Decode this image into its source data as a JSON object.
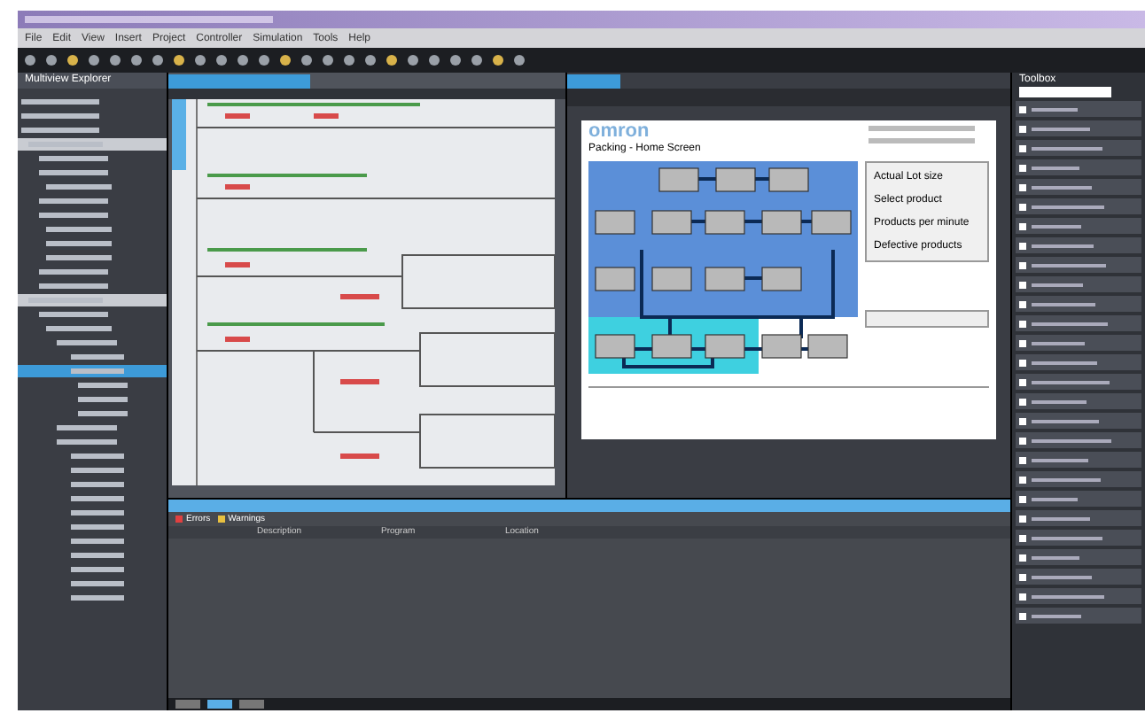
{
  "menu": [
    "File",
    "Edit",
    "View",
    "Insert",
    "Project",
    "Controller",
    "Simulation",
    "Tools",
    "Help"
  ],
  "explorer": {
    "title": "Multiview Explorer"
  },
  "hmi": {
    "logo": "omron",
    "screen_title": "Packing - Home Screen",
    "info": [
      "Actual Lot size",
      "Select product",
      "Products per minute",
      "Defective products"
    ]
  },
  "toolbox": {
    "title": "Toolbox"
  },
  "output": {
    "filters": [
      {
        "label": "Errors",
        "kind": "error"
      },
      {
        "label": "Warnings",
        "kind": "warning"
      }
    ],
    "columns": [
      "Description",
      "Program",
      "Location"
    ],
    "tabs": [
      {
        "selected": false
      },
      {
        "selected": true
      },
      {
        "selected": false
      }
    ]
  }
}
